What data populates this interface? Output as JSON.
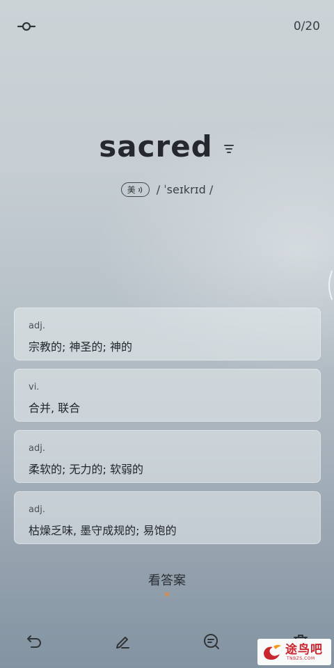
{
  "header": {
    "progress": "0/20",
    "settings_icon": "slider-settings-icon"
  },
  "word": {
    "text": "sacred",
    "menu_icon": "filter-list-icon",
    "accent_label": "美",
    "speaker_icon": "sound-wave-icon",
    "phonetic": "/ ˈseɪkrɪd /"
  },
  "options": [
    {
      "pos": "adj.",
      "meaning": "宗教的; 神圣的; 神的"
    },
    {
      "pos": "vi.",
      "meaning": "合并, 联合"
    },
    {
      "pos": "adj.",
      "meaning": "柔软的; 无力的; 软弱的"
    },
    {
      "pos": "adj.",
      "meaning": "枯燥乏味, 墨守成规的; 易饱的"
    }
  ],
  "show_answer_label": "看答案",
  "toolbar": {
    "icons": [
      "undo-icon",
      "edit-icon",
      "search-icon",
      "delete-icon"
    ]
  },
  "watermark": {
    "text": "途鸟吧",
    "sub": "TNBZS.COM"
  },
  "colors": {
    "accent_dot": "#d98a55",
    "watermark_red": "#c9262f"
  }
}
